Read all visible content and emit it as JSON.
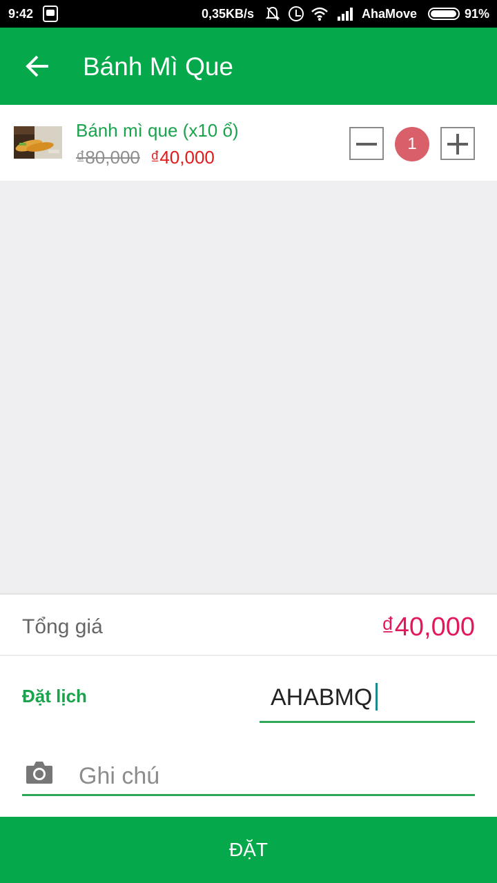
{
  "status_bar": {
    "time": "9:42",
    "network_speed": "0,35KB/s",
    "carrier": "AhaMove",
    "battery": "91%",
    "battery_level": 0.91
  },
  "header": {
    "title": "Bánh Mì Que"
  },
  "cart": {
    "items": [
      {
        "name": "Bánh mì que (x10 ổ)",
        "old_price": "₫80,000",
        "new_price": "₫40,000",
        "quantity": "1"
      }
    ]
  },
  "summary": {
    "total_label": "Tổng giá",
    "total_value": "₫40,000"
  },
  "schedule": {
    "label": "Đặt lịch",
    "promo_value": "AHABMQ"
  },
  "note": {
    "placeholder": "Ghi chú"
  },
  "submit": {
    "label": "ĐẶT"
  },
  "colors": {
    "brand_green": "#05a84a",
    "price_red": "#e11a1a",
    "total_pink": "#e2185b",
    "qty_badge": "#d9606a"
  }
}
